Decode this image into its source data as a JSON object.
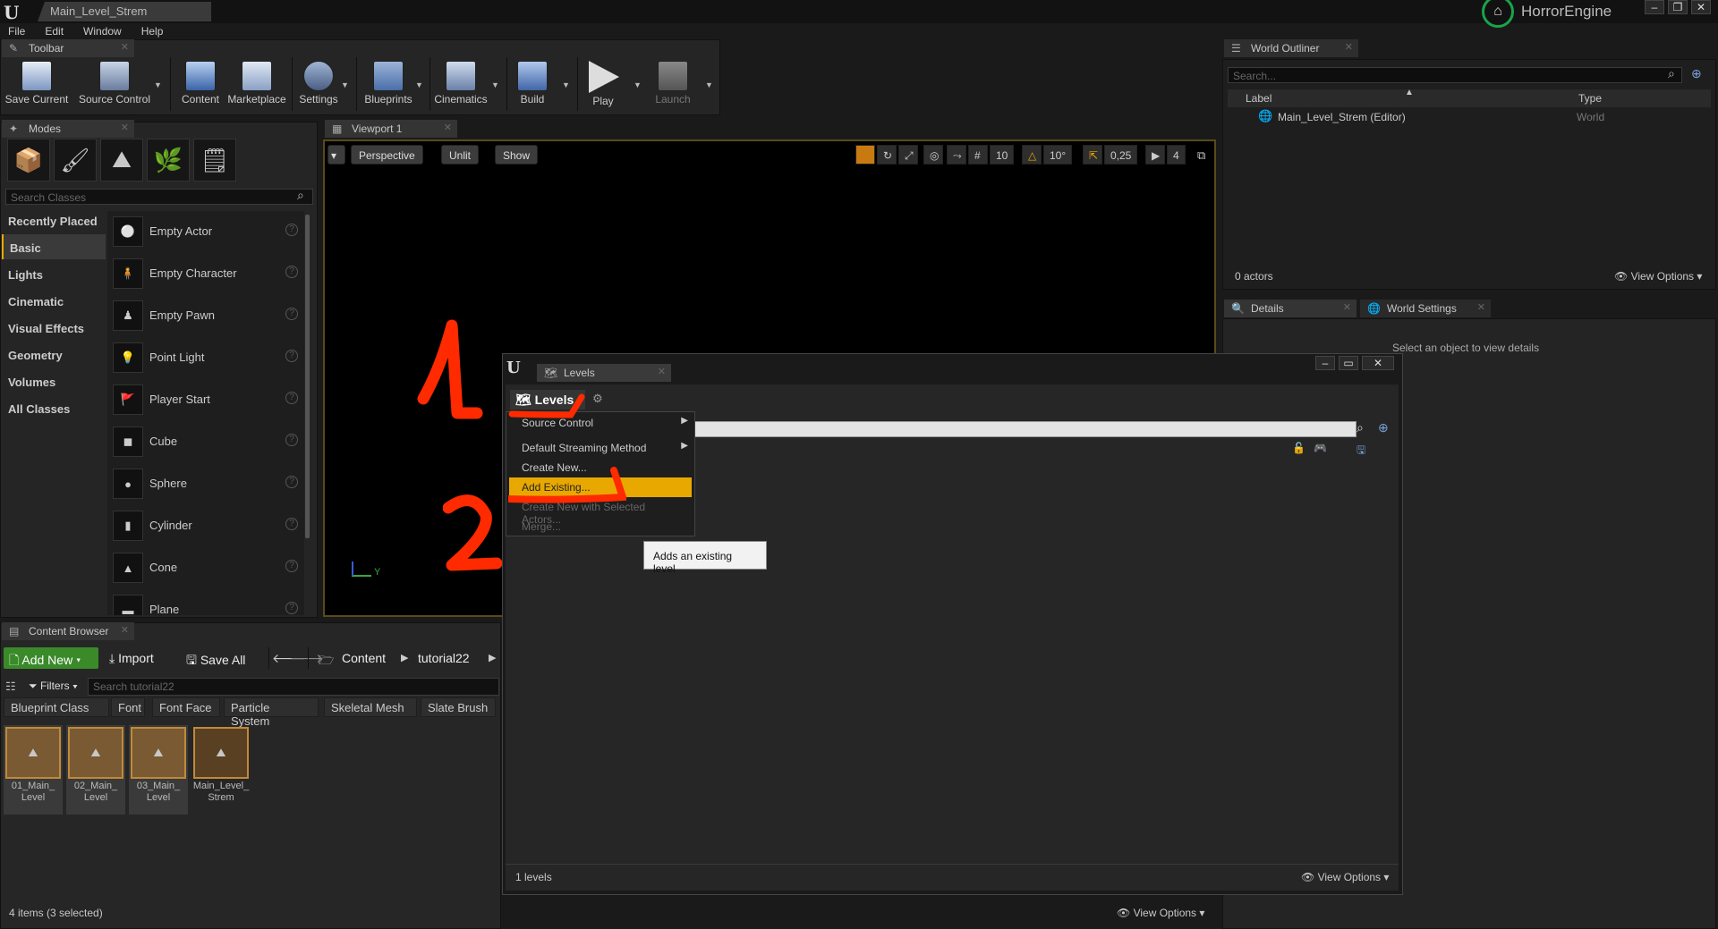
{
  "window": {
    "doc_tab": "Main_Level_Strem",
    "brand": "HorrorEngine",
    "controls": [
      "–",
      "❐",
      "✕"
    ]
  },
  "menubar": [
    "File",
    "Edit",
    "Window",
    "Help"
  ],
  "toolbar": {
    "tab": "Toolbar",
    "buttons": [
      {
        "label": "Save Current",
        "icon": "save-icon"
      },
      {
        "label": "Source Control",
        "icon": "source-control-icon"
      },
      {
        "label": "Content",
        "icon": "content-icon"
      },
      {
        "label": "Marketplace",
        "icon": "marketplace-icon"
      },
      {
        "label": "Settings",
        "icon": "settings-icon"
      },
      {
        "label": "Blueprints",
        "icon": "blueprints-icon"
      },
      {
        "label": "Cinematics",
        "icon": "cinematics-icon"
      },
      {
        "label": "Build",
        "icon": "build-icon"
      },
      {
        "label": "Play",
        "icon": "play-icon"
      },
      {
        "label": "Launch",
        "icon": "launch-icon"
      }
    ]
  },
  "modes": {
    "tab": "Modes",
    "search_placeholder": "Search Classes",
    "categories": [
      "Recently Placed",
      "Basic",
      "Lights",
      "Cinematic",
      "Visual Effects",
      "Geometry",
      "Volumes",
      "All Classes"
    ],
    "selected_category": "Basic",
    "items": [
      "Empty Actor",
      "Empty Character",
      "Empty Pawn",
      "Point Light",
      "Player Start",
      "Cube",
      "Sphere",
      "Cylinder",
      "Cone",
      "Plane"
    ]
  },
  "viewport": {
    "tab": "Viewport 1",
    "perspective": "Perspective",
    "unlit": "Unlit",
    "show": "Show",
    "grid_snap": "10",
    "rot_snap": "10°",
    "scale_snap": "0,25",
    "cam_speed": "4",
    "axis_y": "Y",
    "annotations": {
      "one": "1",
      "two": "2"
    }
  },
  "outliner": {
    "tab": "World Outliner",
    "search_placeholder": "Search...",
    "col_label": "Label",
    "col_type": "Type",
    "row_label": "Main_Level_Strem (Editor)",
    "row_type": "World",
    "status": "0 actors",
    "view_options": "View Options"
  },
  "details": {
    "tab_details": "Details",
    "tab_world": "World Settings",
    "empty": "Select an object to view details"
  },
  "levels": {
    "tab": "Levels",
    "menu_button": "Levels",
    "menu": [
      {
        "label": "Source Control",
        "submenu": true
      },
      {
        "label": "Default Streaming Method",
        "submenu": true
      },
      {
        "label": "Create New..."
      },
      {
        "label": "Add Existing...",
        "highlight": true
      },
      {
        "label": "Create New with Selected Actors...",
        "disabled": true
      },
      {
        "label": "Merge...",
        "disabled": true
      }
    ],
    "tooltip": "Adds an existing level",
    "status": "1 levels",
    "view_options": "View Options"
  },
  "content_browser": {
    "tab": "Content Browser",
    "add_new": "Add New",
    "import": "Import",
    "save_all": "Save All",
    "path": [
      "Content",
      "tutorial22"
    ],
    "filters": "Filters",
    "search_placeholder": "Search tutorial22",
    "filter_chips": [
      "Blueprint Class",
      "Font",
      "Font Face",
      "Particle System",
      "Skeletal Mesh",
      "Slate Brush"
    ],
    "assets": [
      "01_Main_ Level",
      "02_Main_ Level",
      "03_Main_ Level",
      "Main_Level_ Strem"
    ],
    "status": "4 items (3 selected)",
    "view_options": "View Options"
  },
  "colors": {
    "highlight": "#e8a800",
    "annotation": "#ff2a00",
    "accent_green": "#3a8a2a"
  }
}
